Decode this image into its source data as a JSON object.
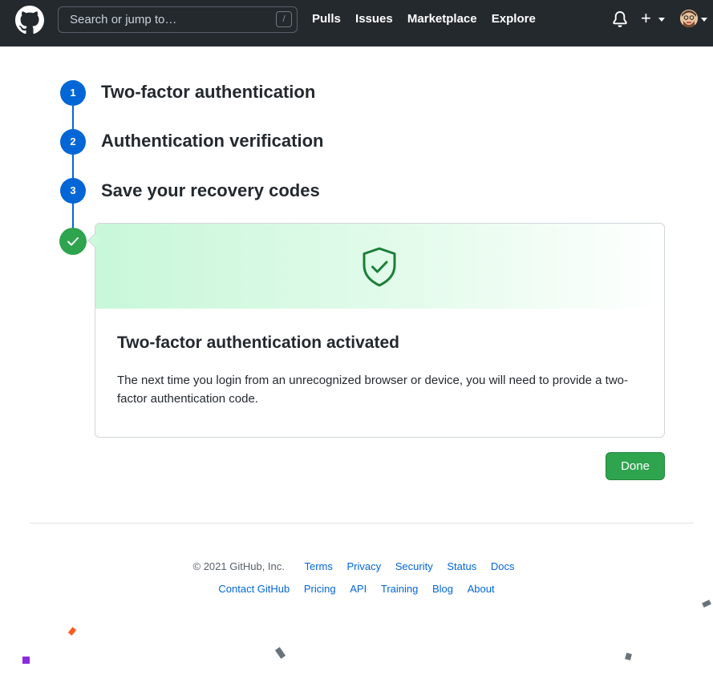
{
  "header": {
    "search_placeholder": "Search or jump to…",
    "search_shortcut": "/",
    "nav": [
      "Pulls",
      "Issues",
      "Marketplace",
      "Explore"
    ],
    "plus_label": "+"
  },
  "steps": [
    {
      "number": "1",
      "title": "Two-factor authentication"
    },
    {
      "number": "2",
      "title": "Authentication verification"
    },
    {
      "number": "3",
      "title": "Save your recovery codes"
    }
  ],
  "card": {
    "title": "Two-factor authentication activated",
    "body": "The next time you login from an unrecognized browser or device, you will need to provide a two-factor authentication code."
  },
  "done_label": "Done",
  "footer": {
    "copyright": "© 2021 GitHub, Inc.",
    "row1": [
      "Terms",
      "Privacy",
      "Security",
      "Status",
      "Docs"
    ],
    "row2": [
      "Contact GitHub",
      "Pricing",
      "API",
      "Training",
      "Blog",
      "About"
    ]
  },
  "colors": {
    "header_bg": "#24292e",
    "step_blue": "#0366d6",
    "success_green": "#2ea44f",
    "link_blue": "#0366d6"
  }
}
